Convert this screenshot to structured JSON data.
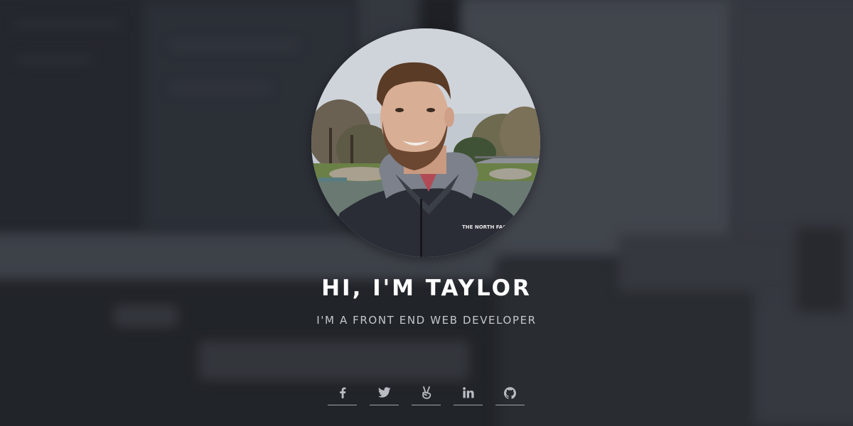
{
  "hero": {
    "title": "HI, I'M TAYLOR",
    "subtitle": "I'M A FRONT END WEB DEVELOPER"
  },
  "avatar": {
    "alt": "Profile photo",
    "jacket_logo": "THE NORTH FACE"
  },
  "social": {
    "links": [
      {
        "icon": "facebook-icon",
        "label": "Facebook"
      },
      {
        "icon": "twitter-icon",
        "label": "Twitter"
      },
      {
        "icon": "angellist-icon",
        "label": "AngelList"
      },
      {
        "icon": "linkedin-icon",
        "label": "LinkedIn"
      },
      {
        "icon": "github-icon",
        "label": "GitHub"
      }
    ]
  },
  "colors": {
    "title": "#ffffff",
    "subtitle": "#c4c8cd",
    "icon": "#b9bdc3",
    "underline": "#a0a4aa"
  }
}
